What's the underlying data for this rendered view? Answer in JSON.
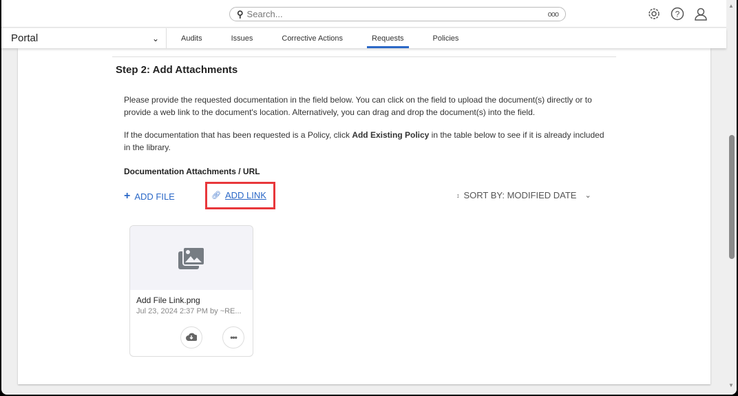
{
  "search": {
    "placeholder": "Search...",
    "more": "ooo"
  },
  "nav": {
    "module": "Portal",
    "tabs": [
      "Audits",
      "Issues",
      "Corrective Actions",
      "Requests",
      "Policies"
    ],
    "active": "Requests"
  },
  "step": {
    "title": "Step 2: Add Attachments",
    "para1": "Please provide the requested documentation in the field below. You can click on the field to upload the document(s) directly or to provide a web link to the document's location. Alternatively, you can drag and drop the document(s) into the field.",
    "para2_pre": "If the documentation that has been requested is a Policy, click ",
    "para2_bold": "Add Existing Policy",
    "para2_post": " in the table below to see if it is already included in the library.",
    "field_label": "Documentation Attachments / URL",
    "add_file": "ADD FILE",
    "add_link": "ADD LINK",
    "sort": "SORT BY: MODIFIED DATE"
  },
  "file": {
    "name": "Add File Link.png",
    "meta": "Jul 23, 2024 2:37 PM by ~RE..."
  },
  "colors": {
    "accent": "#2b68c7",
    "highlight": "#e8373b"
  }
}
